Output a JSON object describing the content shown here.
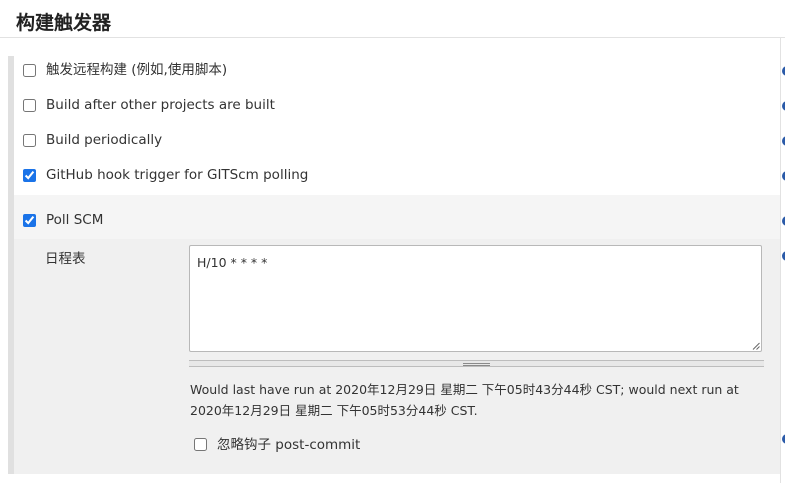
{
  "section": {
    "title": "构建触发器"
  },
  "triggers": [
    {
      "label": "触发远程构建 (例如,使用脚本)",
      "checked": false
    },
    {
      "label": "Build after other projects are built",
      "checked": false
    },
    {
      "label": "Build periodically",
      "checked": false
    },
    {
      "label": "GitHub hook trigger for GITScm polling",
      "checked": true
    },
    {
      "label": "Poll SCM",
      "checked": true
    }
  ],
  "poll_scm": {
    "schedule_label": "日程表",
    "schedule_value": "H/10 * * * *",
    "note_line1": "Would last have run at 2020年12月29日 星期二 下午05时43分44秒 CST; would next run at",
    "note_line2": "2020年12月29日 星期二 下午05时53分44秒 CST.",
    "ignore_post_commit_label": "忽略钩子 post-commit",
    "ignore_post_commit_checked": false
  },
  "colors": {
    "accent": "#1a73e8",
    "help_icon": "#2a5aa8"
  }
}
